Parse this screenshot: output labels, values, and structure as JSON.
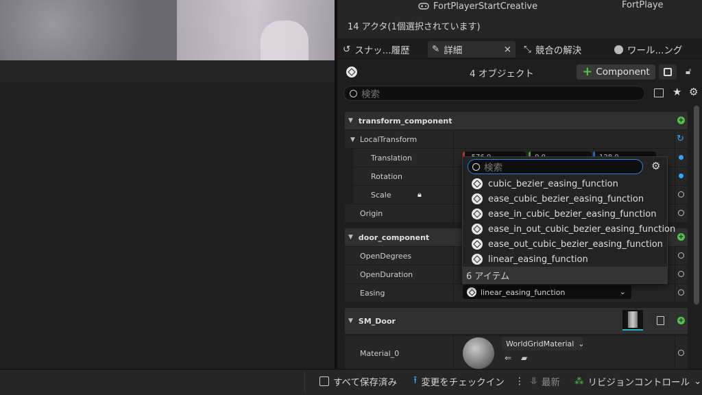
{
  "outliner": {
    "col1": "FortPlayerStartCreative",
    "col2": "FortPlaye",
    "actor_count": "14 アクタ(1個選択されています)"
  },
  "tabs": [
    {
      "label": "スナッ...履歴"
    },
    {
      "label": "詳細",
      "close": "×"
    },
    {
      "label": "競合の解決"
    },
    {
      "label": "ワール...ング"
    }
  ],
  "details": {
    "object_count": "4 オブジェクト",
    "add_component_label": "Component",
    "search_placeholder": "検索"
  },
  "categories": [
    {
      "title": "transform_component"
    },
    {
      "title": "door_component"
    },
    {
      "title": "SM_Door"
    }
  ],
  "properties": {
    "local_transform": "LocalTransform",
    "translation": "Translation",
    "translation_values": [
      "-576.0",
      "0.0",
      "128.0"
    ],
    "rotation": "Rotation",
    "scale": "Scale",
    "origin": "Origin",
    "open_degrees": "OpenDegrees",
    "open_duration": "OpenDuration",
    "easing": "Easing",
    "easing_value": "linear_easing_function",
    "material_0": "Material_0",
    "material_value": "WorldGridMaterial"
  },
  "dropdown": {
    "search_placeholder": "検索",
    "items": [
      "cubic_bezier_easing_function",
      "ease_cubic_bezier_easing_function",
      "ease_in_cubic_bezier_easing_function",
      "ease_in_out_cubic_bezier_easing_function",
      "ease_out_cubic_bezier_easing_function",
      "linear_easing_function"
    ],
    "footer": "6 アイテム"
  },
  "statusbar": {
    "save_all": "すべて保存済み",
    "checkin": "変更をチェックイン",
    "latest": "最新",
    "revision_control": "リビジョンコントロール"
  },
  "colors": {
    "accent_green": "#54c54a",
    "accent_blue": "#2ea8ff",
    "panel_bg": "#1e1e1e"
  }
}
